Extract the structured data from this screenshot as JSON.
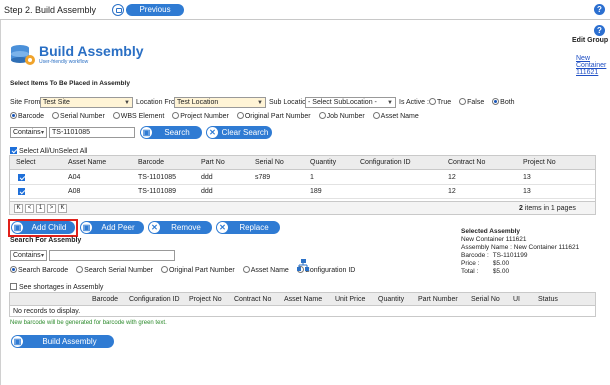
{
  "header": {
    "step_title": "Step 2. Build Assembly",
    "previous_label": "Previous",
    "help_label": "?"
  },
  "brand": {
    "title": "Build Assembly",
    "tagline": "User-friendly workflow"
  },
  "right_panel": {
    "edit_group_label": "Edit Group",
    "new_container_link_line1": "New",
    "new_container_link_line2": "Container",
    "new_container_link_line3": "111621"
  },
  "selection": {
    "heading": "Select Items To Be Placed in Assembly",
    "site_from_label": "Site From :",
    "site_from_value": "Test Site",
    "location_from_label": "Location From",
    "location_from_value": "Test Location",
    "sub_location_label": "Sub Location",
    "sub_location_value": "- Select SubLocation -",
    "is_active_label": "Is Active :",
    "is_active_options": [
      "True",
      "False",
      "Both"
    ],
    "is_active_selected": "Both",
    "search_by_options": [
      "Barcode",
      "Serial Number",
      "WBS Element",
      "Project Number",
      "Original Part Number",
      "Job Number",
      "Asset Name"
    ],
    "search_by_selected": "Barcode",
    "operator_value": "Contains",
    "search_value": "TS-1101085",
    "search_button": "Search",
    "clear_button": "Clear Search",
    "select_all_label": "Select All/UnSelect All"
  },
  "items_table": {
    "columns": [
      "Select",
      "Asset Name",
      "Barcode",
      "Part No",
      "Serial No",
      "Quantity",
      "Configuration ID",
      "Contract No",
      "Project No"
    ],
    "rows": [
      {
        "asset_name": "A04",
        "barcode": "TS-1101085",
        "part_no": "ddd",
        "serial_no": "s789",
        "quantity": "1",
        "configuration_id": "",
        "contract_no": "12",
        "project_no": "13"
      },
      {
        "asset_name": "A08",
        "barcode": "TS-1101089",
        "part_no": "ddd",
        "serial_no": "",
        "quantity": "189",
        "configuration_id": "",
        "contract_no": "12",
        "project_no": "13"
      }
    ],
    "pager": {
      "first": "K",
      "prev": "<",
      "page": "1",
      "next": ">",
      "last": "K",
      "summary_count": "2",
      "summary_text": "items in 1 pages"
    }
  },
  "actions": {
    "add_child": "Add Child",
    "add_peer": "Add Peer",
    "remove": "Remove",
    "replace": "Replace"
  },
  "assembly_search": {
    "heading": "Search For Assembly",
    "operator_value": "Contains",
    "search_value": "",
    "options": [
      "Search Barcode",
      "Search Serial Number",
      "Original Part Number",
      "Asset Name",
      "Configuration ID"
    ],
    "selected": "Search Barcode",
    "shortages_label": "See shortages in Assembly"
  },
  "selected_assembly": {
    "heading": "Selected Assembly",
    "name": "New Container 111621",
    "assembly_name_label": "Assembly Name :",
    "assembly_name_value": "New Container 111621",
    "barcode_label": "Barcode :",
    "barcode_value": "TS-1101199",
    "price_label": "Price :",
    "price_value": "$5.00",
    "total_label": "Total :",
    "total_value": "$5.00"
  },
  "assembly_table": {
    "columns": [
      "Barcode",
      "Configuration ID",
      "Project No",
      "Contract No",
      "Asset Name",
      "Unit Price",
      "Quantity",
      "Part Number",
      "Serial No",
      "UI",
      "Status"
    ],
    "empty_text": "No records to display."
  },
  "footer": {
    "note": "New barcode will be generated for barcode with green text.",
    "build_button": "Build Assembly"
  },
  "colors": {
    "accent": "#2f7bd3",
    "highlight_border": "#e0201a",
    "note_green": "#2b8a2b"
  }
}
